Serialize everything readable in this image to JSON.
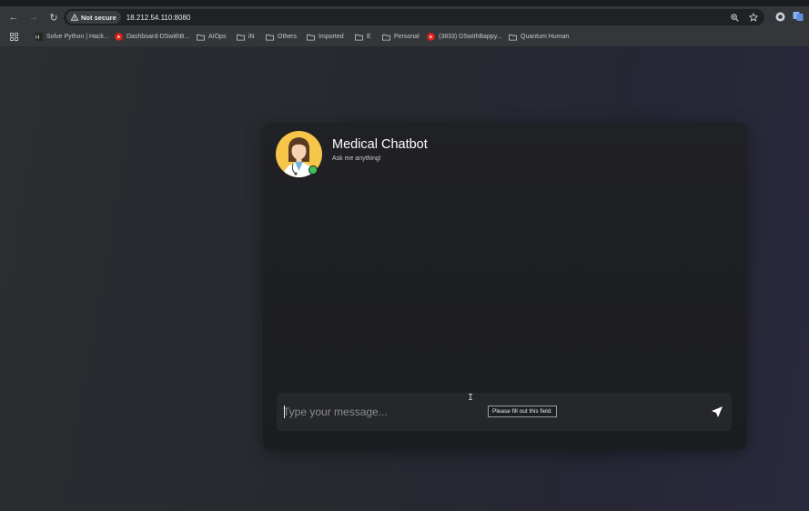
{
  "browser": {
    "security_chip": "Not secure",
    "url": "18.212.54.110:8080",
    "bookmarks": [
      {
        "label": "Solve Python | Hack...",
        "icon": "hackerrank-icon"
      },
      {
        "label": "Dashboard-DSwithB...",
        "icon": "youtube-icon"
      },
      {
        "label": "AIOps",
        "icon": "folder-icon"
      },
      {
        "label": "iN",
        "icon": "folder-icon"
      },
      {
        "label": "Others",
        "icon": "folder-icon"
      },
      {
        "label": "Imported",
        "icon": "folder-icon"
      },
      {
        "label": "E",
        "icon": "folder-icon"
      },
      {
        "label": "Personal",
        "icon": "folder-icon"
      },
      {
        "label": "(3833) DSwithBappy...",
        "icon": "youtube-icon"
      },
      {
        "label": "Quantum Human",
        "icon": "folder-icon"
      }
    ]
  },
  "chat": {
    "title": "Medical Chatbot",
    "subtitle": "Ask me anything!",
    "input_placeholder": "Type your message...",
    "validation_tooltip": "Please fill out this field."
  },
  "colors": {
    "online_status": "#3cc456",
    "avatar_background": "#f5c64a",
    "youtube_red": "#e62117"
  }
}
